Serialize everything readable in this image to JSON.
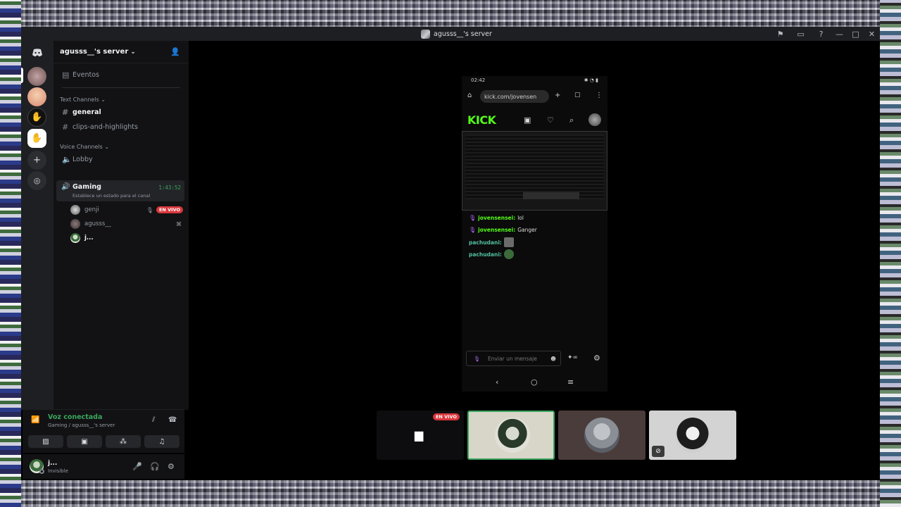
{
  "window": {
    "title": "agusss__'s server"
  },
  "titlebar_icons": [
    "flag-icon",
    "inbox-icon",
    "help-icon",
    "minimize-icon",
    "maximize-icon",
    "close-icon"
  ],
  "server": {
    "name": "agusss__'s server"
  },
  "sidebar": {
    "events_label": "Eventos",
    "text_category": "Text Channels",
    "text_channels": [
      "general",
      "clips-and-highlights"
    ],
    "voice_category": "Voice Channels",
    "voice_channels": {
      "lobby": "Lobby",
      "gaming": "Gaming",
      "gaming_status": "Establece un estado para el canal",
      "gaming_timer": "1:43:52"
    },
    "voice_users": [
      {
        "name": "genji",
        "live": "EN VIVO"
      },
      {
        "name": "agusss__"
      },
      {
        "name": "j..."
      }
    ]
  },
  "voice_panel": {
    "status": "Voz conectada",
    "sub": "Gaming / agusss__'s server"
  },
  "user_panel": {
    "name": "j...",
    "status": "Invisible"
  },
  "phone": {
    "time": "02:42",
    "url": "kick.com/jovensen",
    "logo": "KICK",
    "chat": [
      {
        "user": "jovensensei:",
        "text": "lol"
      },
      {
        "user": "jovensensei:",
        "text": "Ganger"
      },
      {
        "user": "pachudani:",
        "text": ""
      },
      {
        "user": "pachudani:",
        "text": ""
      }
    ],
    "input_placeholder": "Enviar un mensaje"
  },
  "tiles": {
    "live": "EN VIVO"
  },
  "colors": {
    "accent_green": "#3ba55d",
    "kick_green": "#53fc18",
    "live_red": "#da373c"
  }
}
